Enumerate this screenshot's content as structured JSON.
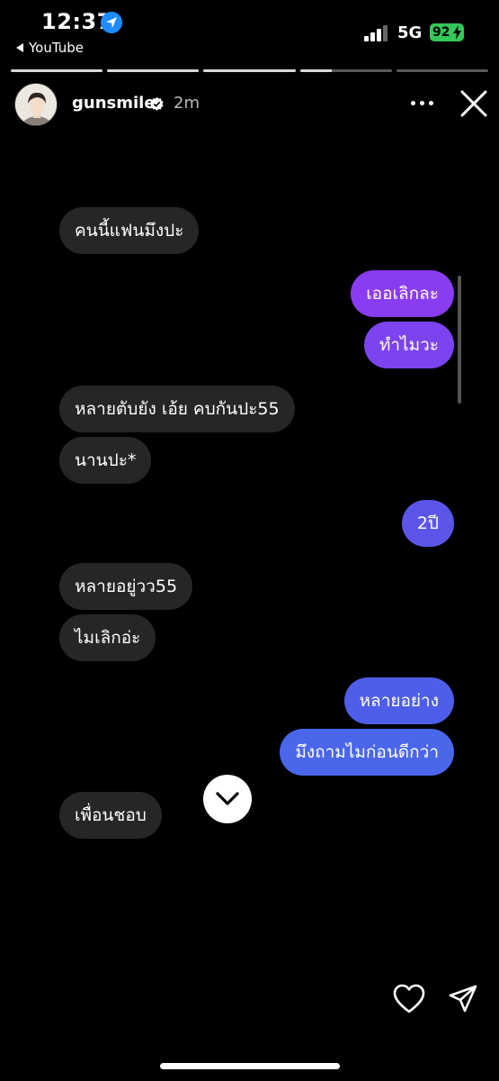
{
  "status_bar": {
    "time": "12:37",
    "back_app": "YouTube",
    "network": "5G",
    "battery": "92"
  },
  "story_progress": [
    1,
    1,
    1,
    0.35,
    0
  ],
  "header": {
    "username": "gunsmile",
    "age": "2m"
  },
  "icons": {
    "location": "location-arrow-icon",
    "verified": "verified-badge-icon",
    "more": "more-dots-icon",
    "close": "close-icon",
    "scroll_down": "chevron-down-icon",
    "like": "heart-icon",
    "share": "paper-plane-icon"
  },
  "colors": {
    "incoming_bubble": "#262626",
    "outgoing_purple": "#7b3fea",
    "outgoing_blue": "#4f5ee8",
    "battery": "#34c759"
  },
  "messages": [
    {
      "from": "them",
      "text": "คนนี้แฟนมึงปะ"
    },
    {
      "from": "me",
      "text": "เออเลิกละ"
    },
    {
      "from": "me",
      "text": "ทำไมวะ"
    },
    {
      "from": "them",
      "text": "หลายตับยัง เอ้ย คบกันปะ55"
    },
    {
      "from": "them",
      "text": "นานปะ*"
    },
    {
      "from": "me",
      "text": "2ปี"
    },
    {
      "from": "them",
      "text": "หลายอยู่วว55"
    },
    {
      "from": "them",
      "text": "ไมเลิกอ่ะ"
    },
    {
      "from": "me",
      "text": "หลายอย่าง"
    },
    {
      "from": "me",
      "text": "มึงถามไมก่อนดีกว่า"
    },
    {
      "from": "them",
      "text": "เพื่อนชอบ"
    }
  ]
}
